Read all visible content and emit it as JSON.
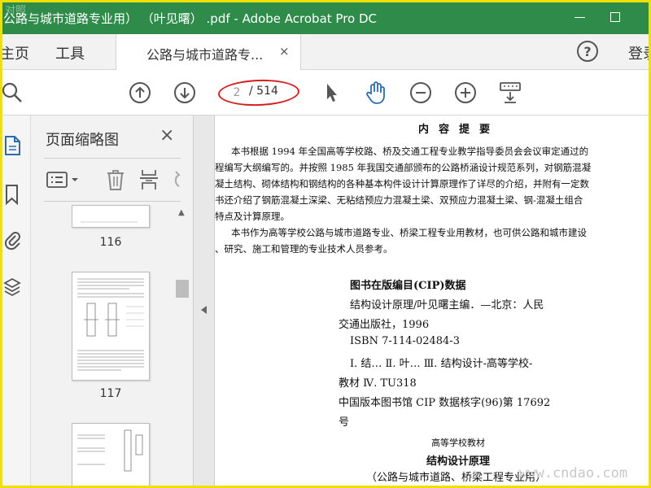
{
  "window": {
    "title": "公路与城市道路专业用） （叶见曙） .pdf - Adobe Acrobat Pro DC",
    "title_bar_color": "#2e8b4a",
    "corner_mark": "对照"
  },
  "tabs": {
    "home": "主页",
    "tools": "工具",
    "document": "公路与城市道路专...",
    "close": "×",
    "help": "?",
    "sign_in": "登录"
  },
  "toolbar": {
    "page_current": "2",
    "page_total": "/ 514",
    "highlight_color": "#d42020"
  },
  "thumbnails": {
    "title": "页面缩略图",
    "close": "×",
    "pages": [
      "116",
      "117"
    ]
  },
  "document": {
    "heading": "内容提要",
    "paragraph_lines": [
      "本书根据 1994 年全国高等学校路、桥及交通工程专业教学指导委员会会议审定通过的",
      "程编写大纲编写的。并按照 1985 年我国交通部颁布的公路桥涵设计规范系列，对钢筋混凝",
      "凝土结构、砌体结构和钢结构的各种基本构件设计计算原理作了详尽的介绍，并附有一定数",
      "书还介绍了钢筋混凝土深梁、无粘结预应力混凝土梁、双预应力混凝土梁、钢-混凝土组合",
      "特点及计算原理。",
      "本书作为高等学校公路与城市道路专业、桥梁工程专业用教材，也可供公路和城市建设",
      "、研究、施工和管理的专业技术人员参考。"
    ],
    "cip_title": "图书在版编目(CIP)数据",
    "cip_lines": [
      "结构设计原理/叶见曙主编．—北京：人民",
      "交通出版社，1996",
      "ISBN 7-114-02484-3",
      "Ⅰ. 结… Ⅱ. 叶… Ⅲ. 结构设计-高等学校-",
      "教材 Ⅳ. TU318",
      "中国版本图书馆 CIP 数据核字(96)第 17692",
      "号"
    ],
    "footer_series": "高等学校教材",
    "footer_title": "结构设计原理",
    "footer_sub": "（公路与城市道路、桥梁工程专业用）"
  },
  "watermark": "www.cndao.com"
}
